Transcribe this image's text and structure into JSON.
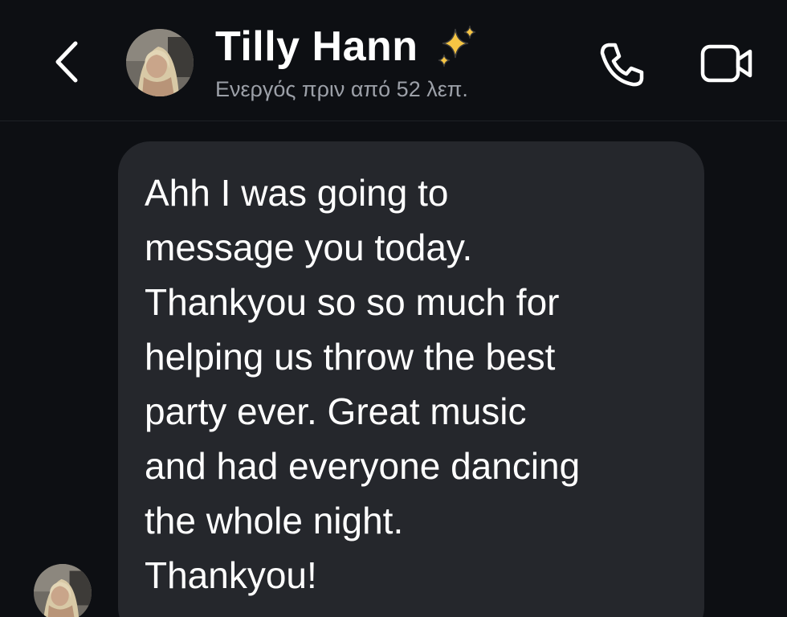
{
  "header": {
    "contact_name": "Tilly Hann",
    "name_emoji": "sparkles-icon",
    "active_status": "Ενεργός πριν από 52 λεπ.",
    "icons": {
      "back": "chevron-left-icon",
      "call": "phone-icon",
      "video": "video-camera-icon"
    }
  },
  "messages": [
    {
      "sender": "Tilly Hann",
      "text": "Ahh I was going to\nmessage you today.\nThankyou so so much for\nhelping us throw the best\nparty ever. Great music\nand had everyone dancing\nthe whole night.\nThankyou!"
    }
  ],
  "colors": {
    "background": "#0d0f13",
    "bubble": "#25272c",
    "status_text": "#9ca0a8",
    "sparkle": "#f6c544"
  }
}
